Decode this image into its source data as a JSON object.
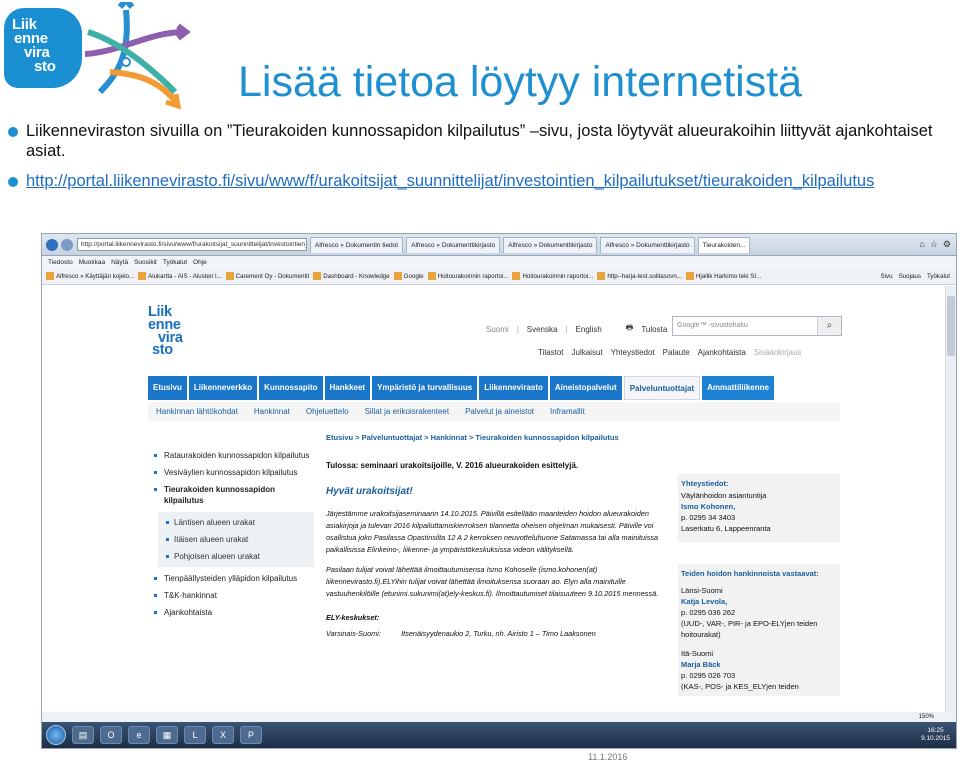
{
  "logo": {
    "lines": [
      "Liik",
      "enne",
      "vira",
      "sto"
    ]
  },
  "slide": {
    "title": "Lisää tietoa löytyy internetistä",
    "bullet1": "Liikenneviraston sivuilla on ”Tieurakoiden kunnossapidon kilpailutus” –sivu, josta löytyvät alueurakoihin liittyvät ajankohtaiset asiat.",
    "bullet2_link": "http://portal.liikennevirasto.fi/sivu/www/f/urakoitsijat_suunnittelijat/investointien_kilpailutukset/tieurakoiden_kilpailutus",
    "footer_date": "11.1.2016"
  },
  "browser": {
    "url": "http://portal.liikennevirasto.fi/sivu/www/f/urakoitsijat_suunnittelijat/investointien_kilp... ",
    "tabs": [
      "Alfresco » Dokumentin tiedot",
      "Alfresco » Dokumenttikirjasto",
      "Alfresco » Dokumenttikirjasto",
      "Alfresco » Dokumenttikirjasto",
      "Tieurakoiden..."
    ],
    "menu": [
      "Tiedosto",
      "Muokkaa",
      "Näytä",
      "Suosikit",
      "Työkalut",
      "Ohje"
    ],
    "favorites": [
      "Alfresco » Käyttäjän kojelo...",
      "Alukartta - AIS - Alusten l...",
      "Carement Oy - Dokumentit",
      "Dashboard - Knowledge",
      "Google",
      "Hoitourakoinnin raportoi...",
      "Hoitourakoinnin raportoi...",
      "http--harja-test.solitasovn...",
      "Hjallik Harkimo teki SI..."
    ],
    "tools": [
      "Sivu",
      "Suojaus",
      "Työkalut"
    ],
    "zoom": "150%"
  },
  "site": {
    "logo_lines": [
      "Liik",
      "enne",
      "vira",
      "sto"
    ],
    "languages": [
      "Suomi",
      "Svenska",
      "English"
    ],
    "print": "Tulosta",
    "search_placeholder": "Google™ -sivustohaku",
    "util": [
      "Tilastot",
      "Julkaisut",
      "Yhteystiedot",
      "Palaute",
      "Ajankohtaista",
      "Sisäänkirjaus"
    ],
    "main_nav": [
      "Etusivu",
      "Liikenneverkko",
      "Kunnossapito",
      "Hankkeet",
      "Ympäristö ja turvallisuus",
      "Liikennevirasto",
      "Aineistopalvelut",
      "Palveluntuottajat",
      "Ammattiliikenne"
    ],
    "sub_nav": [
      "Hankinnan lähtökohdat",
      "Hankinnat",
      "Ohjeluettelo",
      "Sillat ja erikoisrakenteet",
      "Palvelut ja aineistot",
      "Inframallit"
    ],
    "left_nav": {
      "item1": "Ratаurakoiden kunnossapidon kilpailutus",
      "item2": "Vesiväylien kunnossapidon kilpailutus",
      "item3": "Tieurakoiden kunnossapidon kilpailutus",
      "subs": [
        "Läntisen alueen urakat",
        "Itäisen alueen urakat",
        "Pohjoisen alueen urakat"
      ],
      "item4": "Tienpäällysteiden ylläpidon kilpailutus",
      "item5": "T&K-hankinnat",
      "item6": "Ajankohtaista"
    },
    "breadcrumb": "Etusivu > Palveluntuottajat > Hankinnat > Tieurakoiden kunnossapidon kilpailutus",
    "notice": "Tulossa: seminaari urakoitsijoille, V. 2016 alueurakoiden esittelyjä.",
    "greeting": "Hyvät urakoitsijat!",
    "para1": "Järjestämme urakoitsijaseminaarin 14.10.2015. Päivillä esitellään maanteiden hoidon alueurakoiden asiakirjoja ja tulevan 2016 kilpailuttamiskierroksen tilannetta oheisen ohjelman mukaisesti. Päiville voi osallistua joko Pasilassa Opastinsilta 12 A 2 kerroksen neuvotteluhuone Satamassa tai alla mainituissa paikallisissa Elinkeino-, liikenne- ja ympäristökeskuksissa videon välityksellä.",
    "para2": "Pasilaan tulijat voivat lähettää ilmoittautumisensa Ismo Kohoselle (ismo.kohonen(at) liikennevirasto.fi).ELYihin tulijat voivat lähettää ilmoituksensa suoraan ao. Elyn alla mainituille vastuuhenkilöille (etunimi.sukunimi(at)ely-keskus.fi). Ilmoittautumiset tilaisuuteen 9.10.2015 mennessä.",
    "ely_heading": "ELY-keskukset:",
    "ely_row": "Varsinais-Suomi:          Itsenäisyydenaukio 2, Turku, nh. Airisto 1 – Timo Laaksonen",
    "contact": {
      "heading": "Yhteystiedot:",
      "unit": "Väylänhoidon asiantuntija",
      "name": "Ismo Kohonen,",
      "phone": "p. 0295 34 3403",
      "address": "Laserkatu 6, Lappeenranta"
    },
    "contacts2": {
      "heading": "Teiden hoidon hankinnoista vastaavat:",
      "region1": "Länsi-Suomi",
      "name1": "Katja Levola,",
      "phone1": "p. 0295 036 262",
      "desc1": "(UUD-, VAR-, PIR- ja EPO-ELYjen teiden hoitourakat)",
      "region2": "Itä-Suomi",
      "name2": "Marja Bäck",
      "phone2": "p. 0295 026 703",
      "desc2": "(KAS-, POS- ja KES_ELYjen teiden"
    }
  },
  "taskbar": {
    "time": "16:25",
    "date": "9.10.2015"
  }
}
